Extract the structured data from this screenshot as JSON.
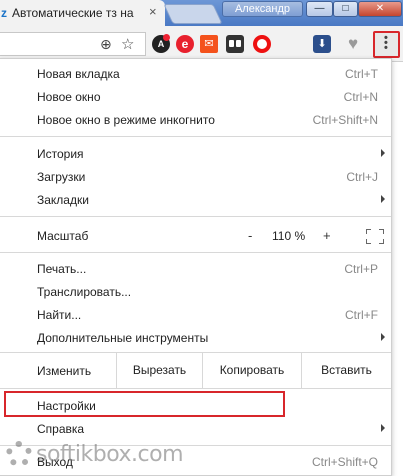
{
  "browser": {
    "tab_favicon": "z",
    "tab_title": "Автоматические тз на",
    "tab_close": "×",
    "user_name": "Александр",
    "window_min": "—",
    "window_max": "□",
    "window_close": "✕"
  },
  "toolbar": {
    "zoom_icon": "⊕",
    "star_icon": "☆",
    "extensions": [
      {
        "name": "adblock-icon",
        "glyph": "A"
      },
      {
        "name": "e-icon",
        "glyph": "e"
      },
      {
        "name": "aliexpress-icon",
        "glyph": "✉"
      },
      {
        "name": "tabs-icon",
        "glyph": ""
      },
      {
        "name": "opera-icon",
        "glyph": ""
      },
      {
        "name": "download-icon",
        "glyph": "⬇"
      },
      {
        "name": "heart-icon",
        "glyph": "♥"
      }
    ],
    "menu_dots": "⋮"
  },
  "menu": {
    "new_tab": {
      "label": "Новая вкладка",
      "shortcut": "Ctrl+T"
    },
    "new_window": {
      "label": "Новое окно",
      "shortcut": "Ctrl+N"
    },
    "incognito": {
      "label": "Новое окно в режиме инкогнито",
      "shortcut": "Ctrl+Shift+N"
    },
    "history": {
      "label": "История"
    },
    "downloads": {
      "label": "Загрузки",
      "shortcut": "Ctrl+J"
    },
    "bookmarks": {
      "label": "Закладки"
    },
    "zoom": {
      "label": "Масштаб",
      "minus": "-",
      "value": "110 %",
      "plus": "+"
    },
    "print": {
      "label": "Печать...",
      "shortcut": "Ctrl+P"
    },
    "cast": {
      "label": "Транслировать..."
    },
    "find": {
      "label": "Найти...",
      "shortcut": "Ctrl+F"
    },
    "more_tools": {
      "label": "Дополнительные инструменты"
    },
    "edit": {
      "label": "Изменить",
      "cut": "Вырезать",
      "copy": "Копировать",
      "paste": "Вставить"
    },
    "settings": {
      "label": "Настройки"
    },
    "help": {
      "label": "Справка"
    },
    "exit": {
      "label": "Выход",
      "shortcut": "Ctrl+Shift+Q"
    }
  },
  "watermark": {
    "text": "softikbox.com"
  },
  "colors": {
    "highlight": "#d8262b",
    "titlebar": "#4a79c4"
  }
}
